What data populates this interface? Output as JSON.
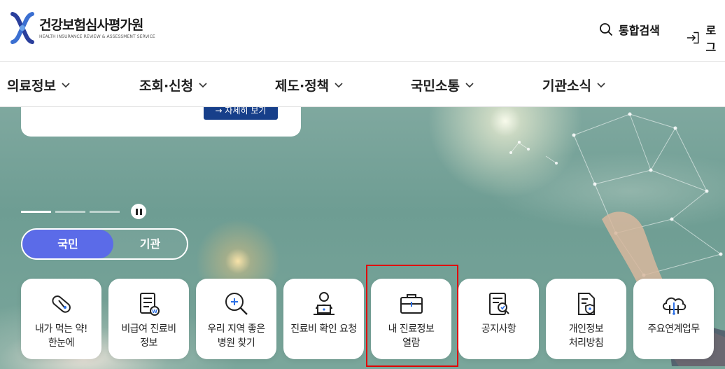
{
  "header": {
    "logo_title": "건강보험심사평가원",
    "logo_subtitle": "HEALTH INSURANCE REVIEW & ASSESSMENT SERVICE",
    "search_label": "통합검색",
    "login_label": "로그"
  },
  "gnb": {
    "items": [
      {
        "label": "의료정보"
      },
      {
        "label": "조회·신청"
      },
      {
        "label": "제도·정책"
      },
      {
        "label": "국민소통"
      },
      {
        "label": "기관소식"
      }
    ]
  },
  "hero": {
    "promo_button_label": "→ 자세히 보기",
    "toggle": {
      "selected": "국민",
      "options": [
        "국민",
        "기관"
      ]
    }
  },
  "quick_menu": [
    {
      "label": "내가 먹는 약!\n한눈에",
      "icon": "pill-icon"
    },
    {
      "label": "비급여 진료비\n정보",
      "icon": "won-document-icon"
    },
    {
      "label": "우리 지역 좋은\n병원 찾기",
      "icon": "search-plus-icon"
    },
    {
      "label": "진료비 확인 요청",
      "icon": "person-laptop-icon"
    },
    {
      "label": "내 진료정보\n열람",
      "icon": "briefcase-icon"
    },
    {
      "label": "공지사항",
      "icon": "notice-document-icon"
    },
    {
      "label": "개인정보\n처리방침",
      "icon": "privacy-shield-icon"
    },
    {
      "label": "주요연계업무",
      "icon": "cloud-network-icon"
    }
  ],
  "colors": {
    "toggle_active": "#5b6be8",
    "promo_button": "#173f8a",
    "highlight_box": "#e00000"
  }
}
